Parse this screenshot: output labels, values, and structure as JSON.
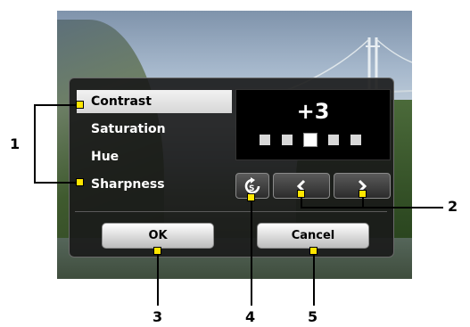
{
  "settings_menu": {
    "items": [
      {
        "label": "Contrast",
        "selected": true
      },
      {
        "label": "Saturation",
        "selected": false
      },
      {
        "label": "Hue",
        "selected": false
      },
      {
        "label": "Sharpness",
        "selected": false
      }
    ]
  },
  "value_display": {
    "value": "+3",
    "levels_total": 5,
    "active_level": 3
  },
  "controls": {
    "reset_icon": "reset-icon",
    "decrease_icon": "chevron-left-icon",
    "increase_icon": "chevron-right-icon"
  },
  "buttons": {
    "ok_label": "OK",
    "cancel_label": "Cancel"
  },
  "callouts": {
    "c1": "1",
    "c2": "2",
    "c3": "3",
    "c4": "4",
    "c5": "5"
  },
  "colors": {
    "callout_marker": "#ffe600",
    "panel_bg": "#1a1a1a",
    "selected_bg": "#e6e6e6"
  }
}
